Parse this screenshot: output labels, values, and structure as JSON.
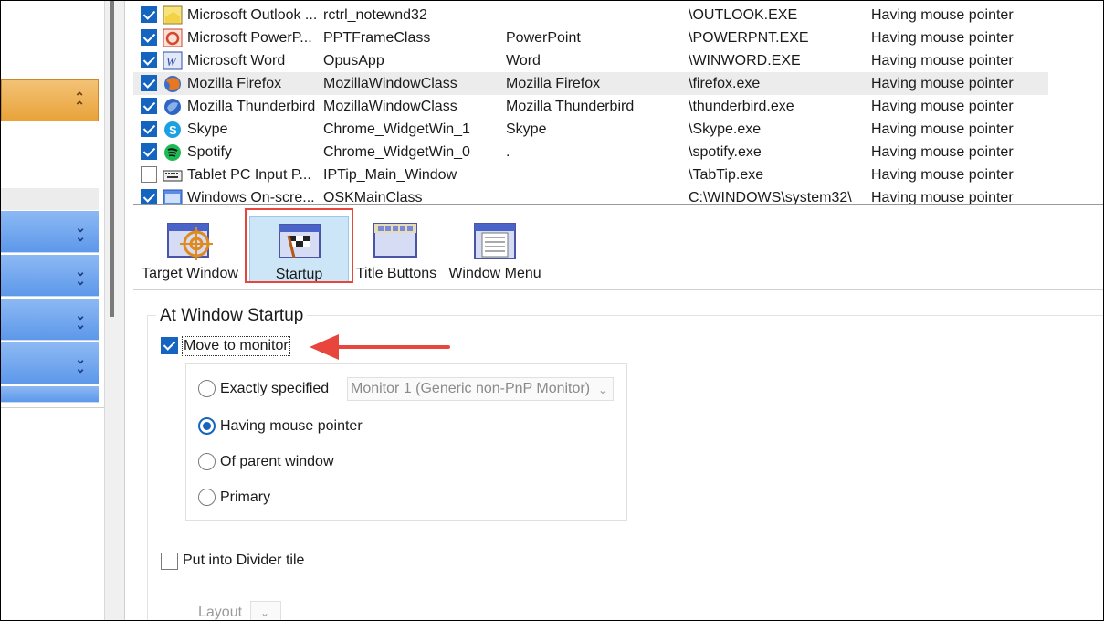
{
  "windows": {
    "rows": [
      {
        "checked": true,
        "icon": "outlook-note-icon",
        "name": "Microsoft Outlook ...",
        "class": "rctrl_notewnd32",
        "title": "",
        "exe": "\\OUTLOOK.EXE",
        "monitor": "Having mouse pointer"
      },
      {
        "checked": true,
        "icon": "powerpoint-icon",
        "name": "Microsoft PowerP...",
        "class": "PPTFrameClass",
        "title": "PowerPoint",
        "exe": "\\POWERPNT.EXE",
        "monitor": "Having mouse pointer"
      },
      {
        "checked": true,
        "icon": "word-icon",
        "name": "Microsoft Word",
        "class": "OpusApp",
        "title": "Word",
        "exe": "\\WINWORD.EXE",
        "monitor": "Having mouse pointer"
      },
      {
        "checked": true,
        "icon": "firefox-icon",
        "name": "Mozilla Firefox",
        "class": "MozillaWindowClass",
        "title": "Mozilla Firefox",
        "exe": "\\firefox.exe",
        "monitor": "Having mouse pointer"
      },
      {
        "checked": true,
        "icon": "thunderbird-icon",
        "name": "Mozilla Thunderbird",
        "class": "MozillaWindowClass",
        "title": "Mozilla Thunderbird",
        "exe": "\\thunderbird.exe",
        "monitor": "Having mouse pointer"
      },
      {
        "checked": true,
        "icon": "skype-icon",
        "name": "Skype",
        "class": "Chrome_WidgetWin_1",
        "title": "Skype",
        "exe": "\\Skype.exe",
        "monitor": "Having mouse pointer"
      },
      {
        "checked": true,
        "icon": "spotify-icon",
        "name": "Spotify",
        "class": "Chrome_WidgetWin_0",
        "title": ".",
        "exe": "\\spotify.exe",
        "monitor": "Having mouse pointer"
      },
      {
        "checked": false,
        "icon": "keyboard-icon",
        "name": "Tablet PC Input P...",
        "class": "IPTip_Main_Window",
        "title": "",
        "exe": "\\TabTip.exe",
        "monitor": "Having mouse pointer"
      },
      {
        "checked": true,
        "icon": "onscreen-keyboard-icon",
        "name": "Windows On-scre...",
        "class": "OSKMainClass",
        "title": "",
        "exe": "C:\\WINDOWS\\system32\\",
        "monitor": "Having mouse pointer"
      }
    ],
    "selected_row": 3
  },
  "tabs": {
    "target_window": "Target Window",
    "startup": "Startup",
    "title_buttons": "Title Buttons",
    "window_menu": "Window Menu",
    "active": "startup"
  },
  "startup": {
    "group_title": "At Window Startup",
    "move_to_monitor": {
      "label": "Move to monitor",
      "checked": true
    },
    "options": {
      "exactly_specified": "Exactly specified",
      "having_mouse_pointer": "Having mouse pointer",
      "of_parent_window": "Of parent window",
      "primary": "Primary",
      "selected": "having_mouse_pointer"
    },
    "monitor_select_value": "Monitor 1 (Generic non-PnP Monitor)",
    "divider_tile": {
      "label": "Put into Divider tile",
      "checked": false
    },
    "layout_label": "Layout"
  },
  "sidebar": {
    "sections": [
      {
        "state": "expanded",
        "icon": "chevron-up-icon"
      },
      {
        "state": "collapsed",
        "icon": "chevron-down-icon"
      },
      {
        "state": "collapsed",
        "icon": "chevron-down-icon"
      },
      {
        "state": "collapsed",
        "icon": "chevron-down-icon"
      },
      {
        "state": "collapsed",
        "icon": "chevron-down-icon"
      }
    ]
  },
  "colors": {
    "accent": "#1565c0",
    "highlight_box": "#e8453c",
    "annotation_arrow": "#e8453c",
    "sidebar_orange": "#e9a33a",
    "sidebar_blue": "#5d98ea"
  }
}
